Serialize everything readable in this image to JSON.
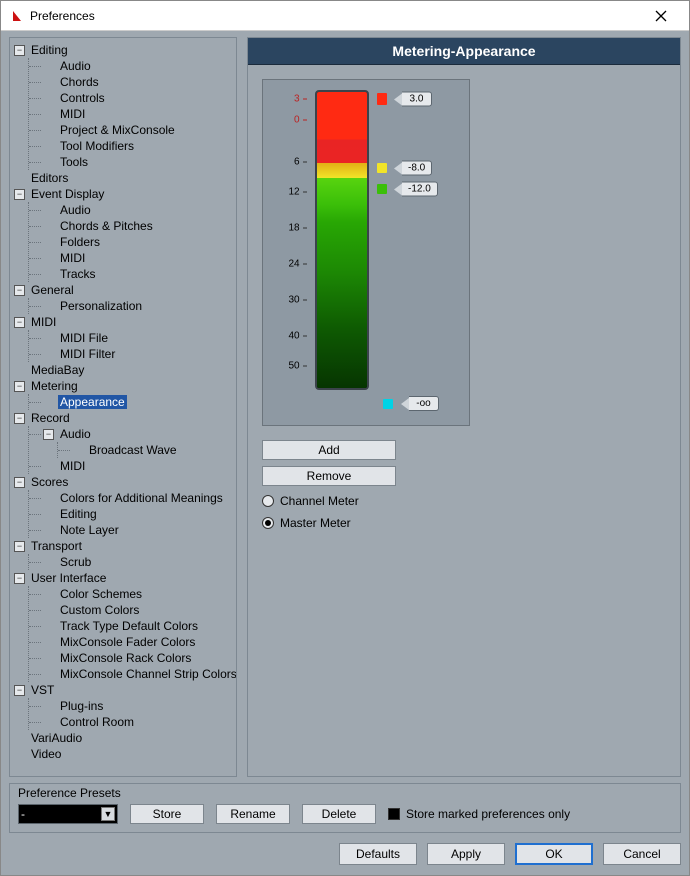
{
  "window": {
    "title": "Preferences"
  },
  "tree": [
    {
      "label": "Editing",
      "children": [
        {
          "label": "Audio"
        },
        {
          "label": "Chords"
        },
        {
          "label": "Controls"
        },
        {
          "label": "MIDI"
        },
        {
          "label": "Project & MixConsole"
        },
        {
          "label": "Tool Modifiers"
        },
        {
          "label": "Tools"
        }
      ]
    },
    {
      "label": "Editors"
    },
    {
      "label": "Event Display",
      "children": [
        {
          "label": "Audio"
        },
        {
          "label": "Chords & Pitches"
        },
        {
          "label": "Folders"
        },
        {
          "label": "MIDI"
        },
        {
          "label": "Tracks"
        }
      ]
    },
    {
      "label": "General",
      "children": [
        {
          "label": "Personalization"
        }
      ]
    },
    {
      "label": "MIDI",
      "children": [
        {
          "label": "MIDI File"
        },
        {
          "label": "MIDI Filter"
        }
      ]
    },
    {
      "label": "MediaBay"
    },
    {
      "label": "Metering",
      "children": [
        {
          "label": "Appearance",
          "selected": true
        }
      ]
    },
    {
      "label": "Record",
      "children": [
        {
          "label": "Audio",
          "children": [
            {
              "label": "Broadcast Wave"
            }
          ]
        },
        {
          "label": "MIDI"
        }
      ]
    },
    {
      "label": "Scores",
      "children": [
        {
          "label": "Colors for Additional Meanings"
        },
        {
          "label": "Editing"
        },
        {
          "label": "Note Layer"
        }
      ]
    },
    {
      "label": "Transport",
      "children": [
        {
          "label": "Scrub"
        }
      ]
    },
    {
      "label": "User Interface",
      "children": [
        {
          "label": "Color Schemes"
        },
        {
          "label": "Custom Colors"
        },
        {
          "label": "Track Type Default Colors"
        },
        {
          "label": "MixConsole Fader Colors"
        },
        {
          "label": "MixConsole Rack Colors"
        },
        {
          "label": "MixConsole Channel Strip Colors"
        }
      ]
    },
    {
      "label": "VST",
      "children": [
        {
          "label": "Plug-ins"
        },
        {
          "label": "Control Room"
        }
      ]
    },
    {
      "label": "VariAudio"
    },
    {
      "label": "Video"
    }
  ],
  "section": {
    "title": "Metering-Appearance"
  },
  "meter_scale": {
    "ticks": [
      {
        "label": "3",
        "pos_pct": 3,
        "accent": "#b22"
      },
      {
        "label": "0",
        "pos_pct": 10,
        "accent": "#b22"
      },
      {
        "label": "6",
        "pos_pct": 24
      },
      {
        "label": "12",
        "pos_pct": 34
      },
      {
        "label": "18",
        "pos_pct": 46
      },
      {
        "label": "24",
        "pos_pct": 58
      },
      {
        "label": "30",
        "pos_pct": 70
      },
      {
        "label": "40",
        "pos_pct": 82
      },
      {
        "label": "50",
        "pos_pct": 92
      }
    ]
  },
  "handles": [
    {
      "label": "3.0",
      "pos_pct": 3,
      "swatch": "red",
      "swatch_h": 12
    },
    {
      "label": "-8.0",
      "pos_pct": 26,
      "swatch": "yellow",
      "swatch_h": 10
    },
    {
      "label": "-12.0",
      "pos_pct": 33,
      "swatch": "green",
      "swatch_h": 10
    }
  ],
  "bottom_handle": {
    "label": "-oo",
    "swatch": "cyan"
  },
  "buttons": {
    "add": "Add",
    "remove": "Remove"
  },
  "radio": {
    "channel": "Channel Meter",
    "master": "Master Meter",
    "selected": "master"
  },
  "preset": {
    "title": "Preference Presets",
    "value": "-",
    "store": "Store",
    "rename": "Rename",
    "delete": "Delete",
    "checkbox": "Store marked preferences only"
  },
  "footer": {
    "defaults": "Defaults",
    "apply": "Apply",
    "ok": "OK",
    "cancel": "Cancel"
  }
}
